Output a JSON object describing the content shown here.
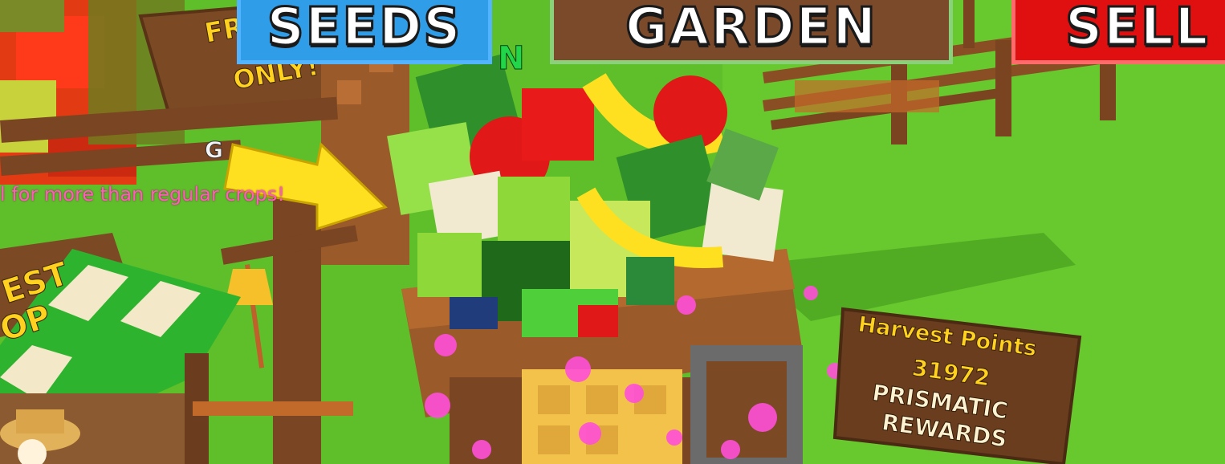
{
  "hud": {
    "seeds_label": "SEEDS",
    "garden_label": "GARDEN",
    "sell_label": "SELL"
  },
  "world": {
    "hint_text": "l for more than regular crops!",
    "event_sign_line1": "FR",
    "event_sign_line2": "ONLY!",
    "event_sign_partial": "G",
    "shop_sign_line1": "EST",
    "shop_sign_line2": "OP",
    "green_sign_partial": "N",
    "harvest_sign": {
      "title": "Harvest Points",
      "value": "31972",
      "line2": "PRISMATIC",
      "line3": "REWARDS"
    }
  },
  "colors": {
    "seeds_button": "#2f9de8",
    "garden_button": "#7a4a2a",
    "sell_button": "#e01010",
    "grass": "#5fbf2a",
    "hint_text": "#ff5cb8",
    "sign_text": "#ffd21f"
  }
}
